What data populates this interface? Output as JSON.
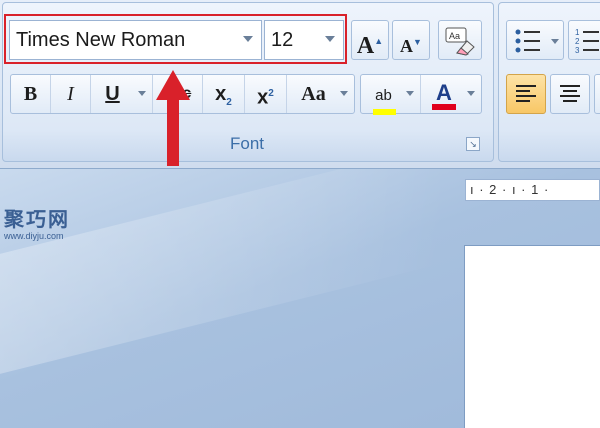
{
  "ribbon": {
    "font_group": {
      "label": "Font",
      "font_name": "Times New Roman",
      "font_size": "12",
      "grow_font_label": "A",
      "shrink_font_label": "A",
      "clear_format_label": "Aa",
      "bold_label": "B",
      "italic_label": "I",
      "underline_label": "U",
      "strike_label": "abc",
      "subscript_label": "x",
      "subscript_mark": "2",
      "superscript_label": "x",
      "superscript_mark": "2",
      "change_case_label": "Aa",
      "highlight_label": "ab",
      "font_color_label": "A",
      "highlight_color": "#ffff00",
      "font_color": "#e0001b"
    }
  },
  "ruler": {
    "text": "ı · 2 · ı · 1 ·"
  },
  "watermark": {
    "main": "聚巧网",
    "sub": "www.diyju.com"
  },
  "colors": {
    "annotation_red": "#d9212a",
    "accent_blue": "#3b6ea8"
  }
}
